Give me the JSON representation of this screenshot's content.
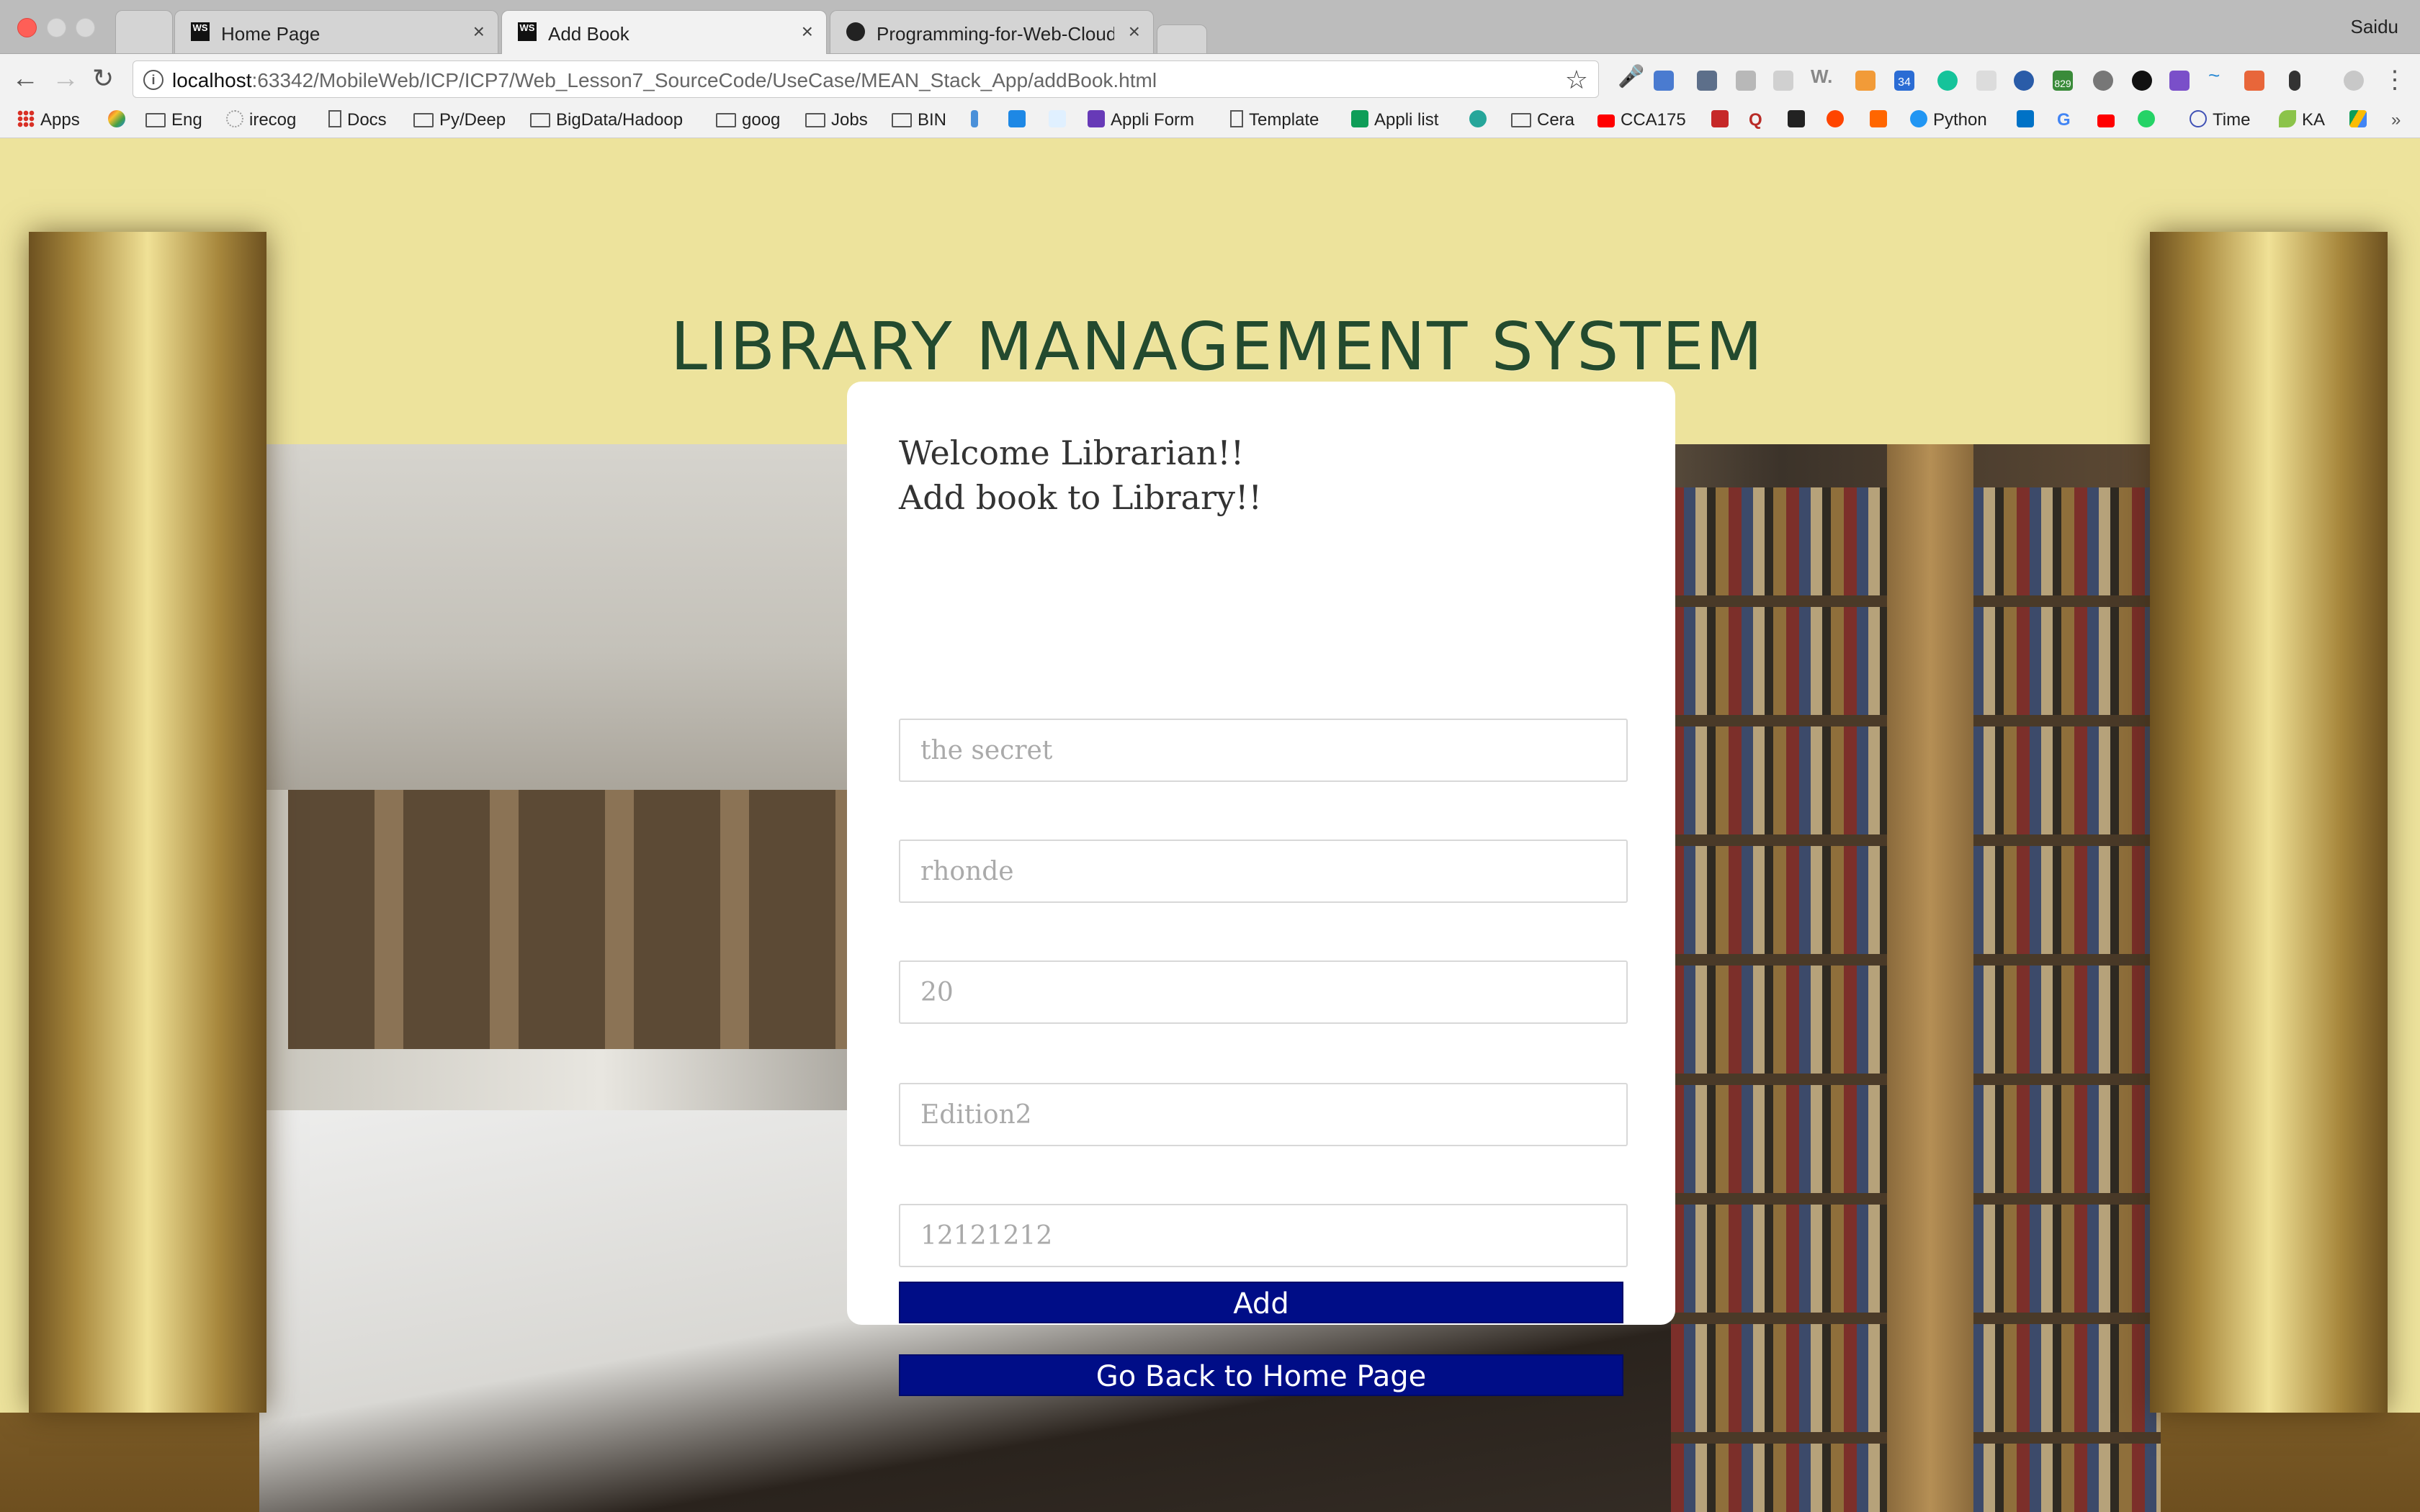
{
  "browser": {
    "tabs": [
      {
        "label": "",
        "favicon": "blank"
      },
      {
        "label": "Home Page",
        "favicon": "WS"
      },
      {
        "label": "Add Book",
        "favicon": "WS",
        "active": true
      },
      {
        "label": "Programming-for-Web-Cloud-",
        "favicon": "github-icon"
      }
    ],
    "user": "Saidu",
    "url_host": "localhost",
    "url_rest": ":63342/MobileWeb/ICP/ICP7/Web_Lesson7_SourceCode/UseCase/MEAN_Stack_App/addBook.html",
    "bookmarks": [
      "Apps",
      "Eng",
      "irecog",
      "Docs",
      "Py/Deep",
      "BigData/Hadoop",
      "goog",
      "Jobs",
      "BIN",
      "Appli Form",
      "Template",
      "Appli list",
      "Cera",
      "CCA175",
      "Python",
      "Time",
      "KA"
    ],
    "extension_badges": {
      "ext_34": "34",
      "ext_829": "829"
    }
  },
  "page": {
    "site_title": "LIBRARY MANAGEMENT SYSTEM",
    "welcome_line1": "Welcome Librarian!!",
    "welcome_line2": "Add book to Library!!",
    "fields": {
      "title": "the secret",
      "author": "rhonde",
      "price": "20",
      "edition": "Edition2",
      "isbn": "12121212"
    },
    "add_button": "Add",
    "back_button": "Go Back to Home Page"
  },
  "colors": {
    "button_bg": "#000d87",
    "page_bg": "#ede39c",
    "title_color": "#234a2e"
  }
}
